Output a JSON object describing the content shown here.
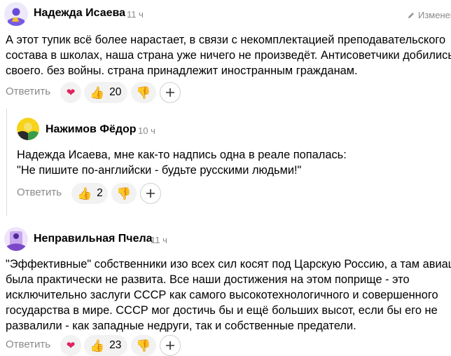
{
  "comments": [
    {
      "author": "Надежда Исаева",
      "time": "11 ч",
      "edited_label": "Изменено",
      "lines": [
        "А этот тупик всё более нарастает, в связи с некомплектацией преподавательского",
        "состава в школах, наша страна уже ничего не произведёт. Антисоветчики добились",
        "своего. без войны. страна принадлежит иностранным гражданам."
      ],
      "reply_label": "Ответить",
      "like_count": "20"
    },
    {
      "author": "Нажимов Фёдор",
      "time": "10 ч",
      "lines": [
        "Надежда Исаева, мне как-то надпись одна в реале попалась:",
        "\"Не пишите по-английски - будьте русскими людьми!\""
      ],
      "reply_label": "Ответить",
      "like_count": "2"
    },
    {
      "author": "Неправильная Пчела",
      "time": "11 ч",
      "lines": [
        "\"Эффективные\" собственники изо всех сил косят под Царскую Россию, а там авиация",
        "была практически не развита. Все наши достижения на этом поприще - это",
        "исключительно заслуги СССР как самого высокотехнологичного и совершенного",
        "государства в мире. СССР мог достичь бы и ещё больших высот, если бы его не",
        "развалили - как западные недруги, так и собственные предатели."
      ],
      "reply_label": "Ответить",
      "like_count": "23"
    }
  ],
  "icons": {
    "heart": "❤",
    "like": "👍",
    "dislike": "👎",
    "plus": "+"
  }
}
